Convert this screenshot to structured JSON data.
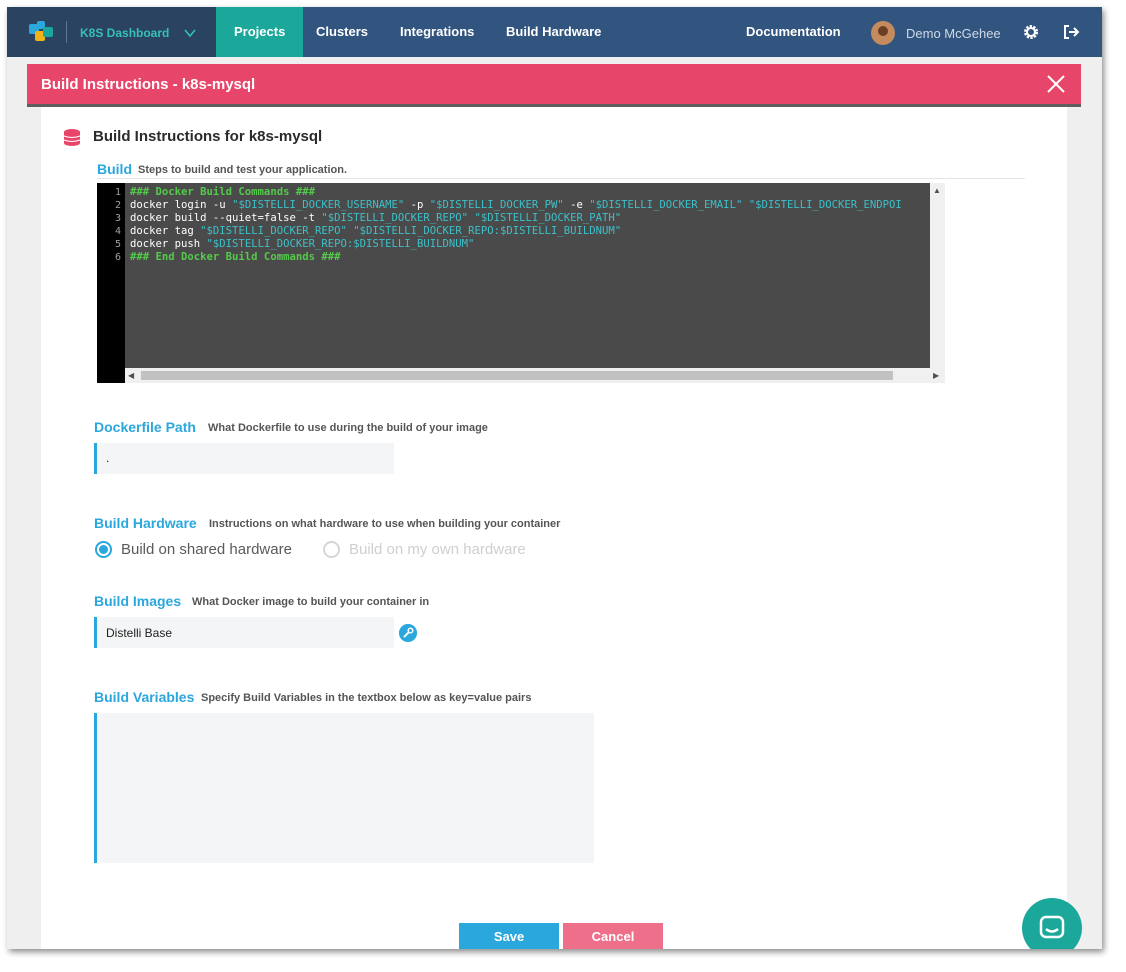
{
  "nav": {
    "brand": "K8S Dashboard",
    "items": [
      {
        "label": "Projects",
        "active": true
      },
      {
        "label": "Clusters",
        "active": false
      },
      {
        "label": "Integrations",
        "active": false
      },
      {
        "label": "Build Hardware",
        "active": false
      }
    ],
    "documentation": "Documentation",
    "user": "Demo McGehee",
    "icons": [
      "app-logo-icon",
      "chevron-down-icon",
      "gear-icon",
      "logout-icon"
    ]
  },
  "modal": {
    "title": "Build Instructions - k8s-mysql",
    "close_icon": "close-icon"
  },
  "section": {
    "title": "Build Instructions for k8s-mysql",
    "icon": "database-icon"
  },
  "build": {
    "label": "Build",
    "description": "Steps to build and test your application.",
    "line_numbers": [
      "1",
      "2",
      "3",
      "4",
      "5",
      "6"
    ],
    "code": [
      "### Docker Build Commands ###",
      "docker login -u \"$DISTELLI_DOCKER_USERNAME\" -p \"$DISTELLI_DOCKER_PW\" -e \"$DISTELLI_DOCKER_EMAIL\" \"$DISTELLI_DOCKER_ENDPOI",
      "docker build --quiet=false -t \"$DISTELLI_DOCKER_REPO\" \"$DISTELLI_DOCKER_PATH\"",
      "docker tag \"$DISTELLI_DOCKER_REPO\" \"$DISTELLI_DOCKER_REPO:$DISTELLI_BUILDNUM\"",
      "docker push \"$DISTELLI_DOCKER_REPO:$DISTELLI_BUILDNUM\"",
      "### End Docker Build Commands ###"
    ]
  },
  "dockerfile": {
    "label": "Dockerfile Path",
    "description": "What Dockerfile to use during the build of your image",
    "value": "."
  },
  "hardware": {
    "label": "Build Hardware",
    "description": "Instructions on what hardware to use when building your container",
    "option_shared": "Build on shared hardware",
    "option_own": "Build on my own hardware",
    "selected": "shared"
  },
  "images": {
    "label": "Build Images",
    "description": "What Docker image to build your container in",
    "value": "Distelli Base",
    "edit_icon": "wrench-icon"
  },
  "variables": {
    "label": "Build Variables",
    "description": "Specify Build Variables in the textbox below as key=value pairs",
    "value": ""
  },
  "actions": {
    "save": "Save",
    "cancel": "Cancel"
  },
  "colors": {
    "nav_bg": "#32557f",
    "nav_active": "#1ba89b",
    "header": "#e8456b",
    "accent": "#2aa7dd",
    "save": "#2aa7dd",
    "cancel": "#ee6f8a"
  },
  "chat_icon": "chat-bubble-icon"
}
